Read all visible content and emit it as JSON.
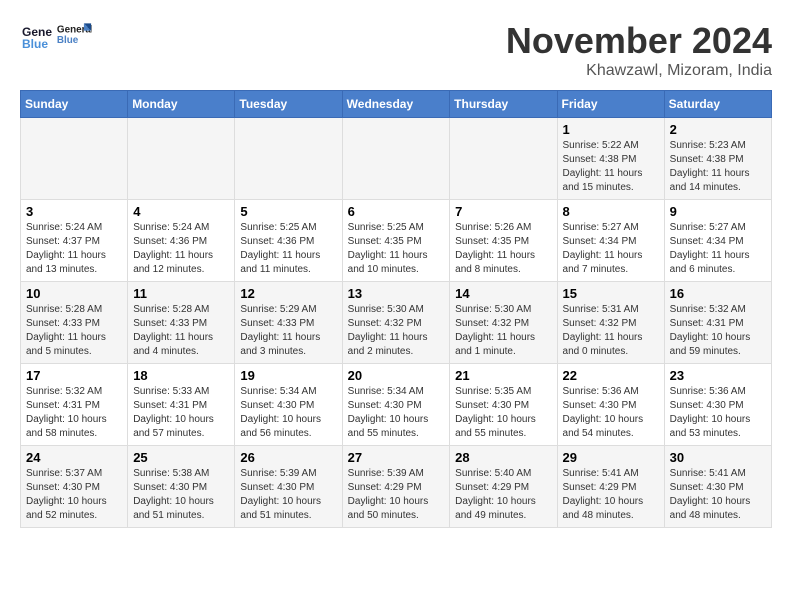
{
  "header": {
    "logo_line1": "General",
    "logo_line2": "Blue",
    "month": "November 2024",
    "location": "Khawzawl, Mizoram, India"
  },
  "weekdays": [
    "Sunday",
    "Monday",
    "Tuesday",
    "Wednesday",
    "Thursday",
    "Friday",
    "Saturday"
  ],
  "weeks": [
    [
      {
        "day": "",
        "content": ""
      },
      {
        "day": "",
        "content": ""
      },
      {
        "day": "",
        "content": ""
      },
      {
        "day": "",
        "content": ""
      },
      {
        "day": "",
        "content": ""
      },
      {
        "day": "1",
        "content": "Sunrise: 5:22 AM\nSunset: 4:38 PM\nDaylight: 11 hours and 15 minutes."
      },
      {
        "day": "2",
        "content": "Sunrise: 5:23 AM\nSunset: 4:38 PM\nDaylight: 11 hours and 14 minutes."
      }
    ],
    [
      {
        "day": "3",
        "content": "Sunrise: 5:24 AM\nSunset: 4:37 PM\nDaylight: 11 hours and 13 minutes."
      },
      {
        "day": "4",
        "content": "Sunrise: 5:24 AM\nSunset: 4:36 PM\nDaylight: 11 hours and 12 minutes."
      },
      {
        "day": "5",
        "content": "Sunrise: 5:25 AM\nSunset: 4:36 PM\nDaylight: 11 hours and 11 minutes."
      },
      {
        "day": "6",
        "content": "Sunrise: 5:25 AM\nSunset: 4:35 PM\nDaylight: 11 hours and 10 minutes."
      },
      {
        "day": "7",
        "content": "Sunrise: 5:26 AM\nSunset: 4:35 PM\nDaylight: 11 hours and 8 minutes."
      },
      {
        "day": "8",
        "content": "Sunrise: 5:27 AM\nSunset: 4:34 PM\nDaylight: 11 hours and 7 minutes."
      },
      {
        "day": "9",
        "content": "Sunrise: 5:27 AM\nSunset: 4:34 PM\nDaylight: 11 hours and 6 minutes."
      }
    ],
    [
      {
        "day": "10",
        "content": "Sunrise: 5:28 AM\nSunset: 4:33 PM\nDaylight: 11 hours and 5 minutes."
      },
      {
        "day": "11",
        "content": "Sunrise: 5:28 AM\nSunset: 4:33 PM\nDaylight: 11 hours and 4 minutes."
      },
      {
        "day": "12",
        "content": "Sunrise: 5:29 AM\nSunset: 4:33 PM\nDaylight: 11 hours and 3 minutes."
      },
      {
        "day": "13",
        "content": "Sunrise: 5:30 AM\nSunset: 4:32 PM\nDaylight: 11 hours and 2 minutes."
      },
      {
        "day": "14",
        "content": "Sunrise: 5:30 AM\nSunset: 4:32 PM\nDaylight: 11 hours and 1 minute."
      },
      {
        "day": "15",
        "content": "Sunrise: 5:31 AM\nSunset: 4:32 PM\nDaylight: 11 hours and 0 minutes."
      },
      {
        "day": "16",
        "content": "Sunrise: 5:32 AM\nSunset: 4:31 PM\nDaylight: 10 hours and 59 minutes."
      }
    ],
    [
      {
        "day": "17",
        "content": "Sunrise: 5:32 AM\nSunset: 4:31 PM\nDaylight: 10 hours and 58 minutes."
      },
      {
        "day": "18",
        "content": "Sunrise: 5:33 AM\nSunset: 4:31 PM\nDaylight: 10 hours and 57 minutes."
      },
      {
        "day": "19",
        "content": "Sunrise: 5:34 AM\nSunset: 4:30 PM\nDaylight: 10 hours and 56 minutes."
      },
      {
        "day": "20",
        "content": "Sunrise: 5:34 AM\nSunset: 4:30 PM\nDaylight: 10 hours and 55 minutes."
      },
      {
        "day": "21",
        "content": "Sunrise: 5:35 AM\nSunset: 4:30 PM\nDaylight: 10 hours and 55 minutes."
      },
      {
        "day": "22",
        "content": "Sunrise: 5:36 AM\nSunset: 4:30 PM\nDaylight: 10 hours and 54 minutes."
      },
      {
        "day": "23",
        "content": "Sunrise: 5:36 AM\nSunset: 4:30 PM\nDaylight: 10 hours and 53 minutes."
      }
    ],
    [
      {
        "day": "24",
        "content": "Sunrise: 5:37 AM\nSunset: 4:30 PM\nDaylight: 10 hours and 52 minutes."
      },
      {
        "day": "25",
        "content": "Sunrise: 5:38 AM\nSunset: 4:30 PM\nDaylight: 10 hours and 51 minutes."
      },
      {
        "day": "26",
        "content": "Sunrise: 5:39 AM\nSunset: 4:30 PM\nDaylight: 10 hours and 51 minutes."
      },
      {
        "day": "27",
        "content": "Sunrise: 5:39 AM\nSunset: 4:29 PM\nDaylight: 10 hours and 50 minutes."
      },
      {
        "day": "28",
        "content": "Sunrise: 5:40 AM\nSunset: 4:29 PM\nDaylight: 10 hours and 49 minutes."
      },
      {
        "day": "29",
        "content": "Sunrise: 5:41 AM\nSunset: 4:29 PM\nDaylight: 10 hours and 48 minutes."
      },
      {
        "day": "30",
        "content": "Sunrise: 5:41 AM\nSunset: 4:30 PM\nDaylight: 10 hours and 48 minutes."
      }
    ]
  ]
}
